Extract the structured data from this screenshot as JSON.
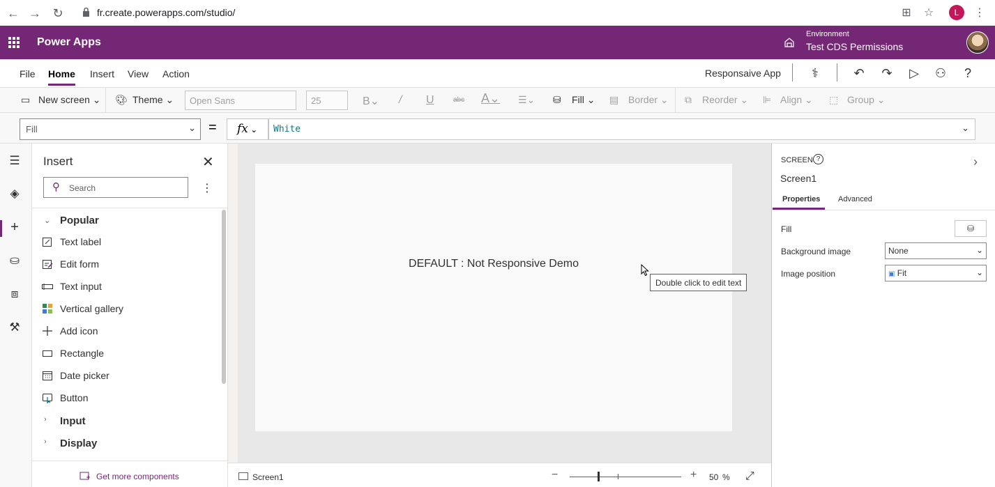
{
  "browser": {
    "url": "fr.create.powerapps.com/studio/",
    "profile_initial": "L"
  },
  "header": {
    "app_title": "Power Apps",
    "environment_label": "Environment",
    "environment_name": "Test CDS Permissions"
  },
  "menu": {
    "items": [
      "File",
      "Home",
      "Insert",
      "View",
      "Action"
    ],
    "active": "Home",
    "app_name": "Responsaive App"
  },
  "toolbar": {
    "new_screen": "New screen",
    "theme": "Theme",
    "font": "Open Sans",
    "font_size": "25",
    "fill": "Fill",
    "border": "Border",
    "reorder": "Reorder",
    "align": "Align",
    "group": "Group"
  },
  "formula": {
    "property": "Fill",
    "equals": "=",
    "fx": "fx",
    "value": "White"
  },
  "insert_panel": {
    "title": "Insert",
    "search_placeholder": "Search",
    "groups": {
      "popular": "Popular",
      "input": "Input",
      "display": "Display"
    },
    "items": [
      {
        "label": "Text label",
        "icon": "text-label-icon"
      },
      {
        "label": "Edit form",
        "icon": "edit-form-icon"
      },
      {
        "label": "Text input",
        "icon": "text-input-icon"
      },
      {
        "label": "Vertical gallery",
        "icon": "gallery-icon"
      },
      {
        "label": "Add icon",
        "icon": "plus-icon"
      },
      {
        "label": "Rectangle",
        "icon": "rectangle-icon"
      },
      {
        "label": "Date picker",
        "icon": "calendar-icon"
      },
      {
        "label": "Button",
        "icon": "button-icon"
      }
    ],
    "footer_link": "Get more components"
  },
  "canvas": {
    "label_text": "DEFAULT : Not Responsive Demo",
    "tooltip": "Double click to edit text"
  },
  "status": {
    "screen_tab": "Screen1",
    "zoom_value": "50",
    "zoom_unit": "%"
  },
  "properties_panel": {
    "type": "SCREEN",
    "name": "Screen1",
    "tabs": [
      "Properties",
      "Advanced"
    ],
    "fill_label": "Fill",
    "background_image_label": "Background image",
    "background_image_value": "None",
    "image_position_label": "Image position",
    "image_position_value": "Fit"
  },
  "colors": {
    "brand": "#742774",
    "formula_text": "#0b7a8a"
  }
}
